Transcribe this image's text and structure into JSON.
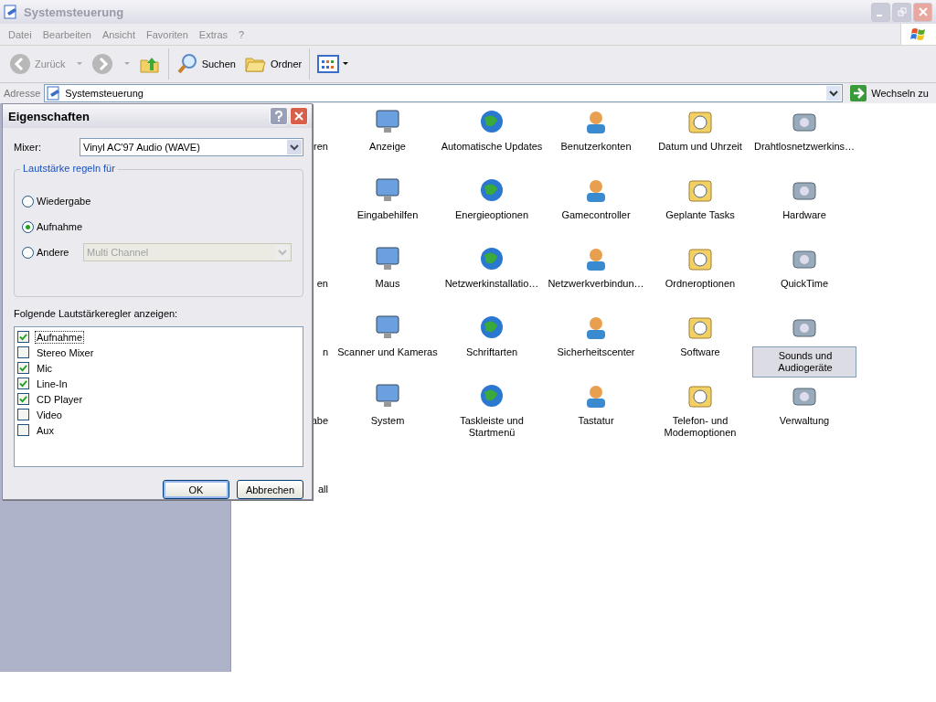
{
  "window": {
    "title": "Systemsteuerung"
  },
  "menu": [
    "Datei",
    "Bearbeiten",
    "Ansicht",
    "Favoriten",
    "Extras",
    "?"
  ],
  "toolbar": {
    "back": {
      "label": "Zurück",
      "disabled": true
    },
    "forward": {
      "disabled": true
    },
    "search": "Suchen",
    "folders": "Ordner"
  },
  "address": {
    "label": "Adresse",
    "value": "Systemsteuerung",
    "go": "Wechseln zu"
  },
  "rows": [
    {
      "items": [
        {
          "kind": "cut",
          "label": "ren"
        },
        {
          "kind": "icon",
          "label": "Anzeige",
          "selected": false
        },
        {
          "kind": "icon",
          "label": "Automatische Updates",
          "selected": false
        },
        {
          "kind": "icon",
          "label": "Benutzerkonten",
          "selected": false
        },
        {
          "kind": "icon",
          "label": "Datum und Uhrzeit",
          "selected": false
        },
        {
          "kind": "icon",
          "label": "Drahtlosnetzwerkins…",
          "selected": false
        }
      ]
    },
    {
      "items": [
        {
          "kind": "icon",
          "label": "Eingabehilfen",
          "selected": false
        },
        {
          "kind": "icon",
          "label": "Energieoptionen",
          "selected": false
        },
        {
          "kind": "icon",
          "label": "Gamecontroller",
          "selected": false
        },
        {
          "kind": "icon",
          "label": "Geplante Tasks",
          "selected": false
        },
        {
          "kind": "icon",
          "label": "Hardware",
          "selected": false
        }
      ]
    },
    {
      "items": [
        {
          "kind": "cut",
          "label": "en"
        },
        {
          "kind": "icon",
          "label": "Maus",
          "selected": false
        },
        {
          "kind": "icon",
          "label": "Netzwerkinstallatio…",
          "selected": false
        },
        {
          "kind": "icon",
          "label": "Netzwerkverbindun…",
          "selected": false
        },
        {
          "kind": "icon",
          "label": "Ordneroptionen",
          "selected": false
        },
        {
          "kind": "icon",
          "label": "QuickTime",
          "selected": false
        }
      ]
    },
    {
      "items": [
        {
          "kind": "cut",
          "label": "n"
        },
        {
          "kind": "icon",
          "label": "Scanner und Kameras",
          "selected": false
        },
        {
          "kind": "icon",
          "label": "Schriftarten",
          "selected": false
        },
        {
          "kind": "icon",
          "label": "Sicherheitscenter",
          "selected": false
        },
        {
          "kind": "icon",
          "label": "Software",
          "selected": false
        },
        {
          "kind": "icon",
          "label": "Sounds und Audiogeräte",
          "selected": true
        }
      ]
    },
    {
      "items": [
        {
          "kind": "cut",
          "label": "abe"
        },
        {
          "kind": "icon",
          "label": "System",
          "selected": false
        },
        {
          "kind": "icon",
          "label": "Taskleiste und Startmenü",
          "selected": false
        },
        {
          "kind": "icon",
          "label": "Tastatur",
          "selected": false
        },
        {
          "kind": "icon",
          "label": "Telefon- und Modemoptionen",
          "selected": false
        },
        {
          "kind": "icon",
          "label": "Verwaltung",
          "selected": false
        }
      ]
    },
    {
      "items": [
        {
          "kind": "cut",
          "label": "all"
        }
      ]
    }
  ],
  "dialog": {
    "title": "Eigenschaften",
    "mixer_label": "Mixer:",
    "mixer_value": "Vinyl AC'97 Audio (WAVE)",
    "group_title": "Lautstärke regeln für",
    "radios": [
      {
        "label": "Wiedergabe",
        "selected": false
      },
      {
        "label": "Aufnahme",
        "selected": true
      },
      {
        "label": "Andere",
        "selected": false
      }
    ],
    "other_select": {
      "value": "Multi Channel",
      "disabled": true
    },
    "list_label": "Folgende Lautstärkeregler anzeigen:",
    "checkboxes": [
      {
        "label": "Aufnahme",
        "checked": true,
        "focused": true
      },
      {
        "label": "Stereo Mixer",
        "checked": false,
        "focused": false
      },
      {
        "label": "Mic",
        "checked": true,
        "focused": false
      },
      {
        "label": "Line-In",
        "checked": true,
        "focused": false
      },
      {
        "label": "CD Player",
        "checked": true,
        "focused": false
      },
      {
        "label": "Video",
        "checked": false,
        "focused": false
      },
      {
        "label": "Aux",
        "checked": false,
        "focused": false
      }
    ],
    "buttons": [
      {
        "label": "OK",
        "default": true
      },
      {
        "label": "Abbrechen",
        "default": false
      }
    ]
  }
}
